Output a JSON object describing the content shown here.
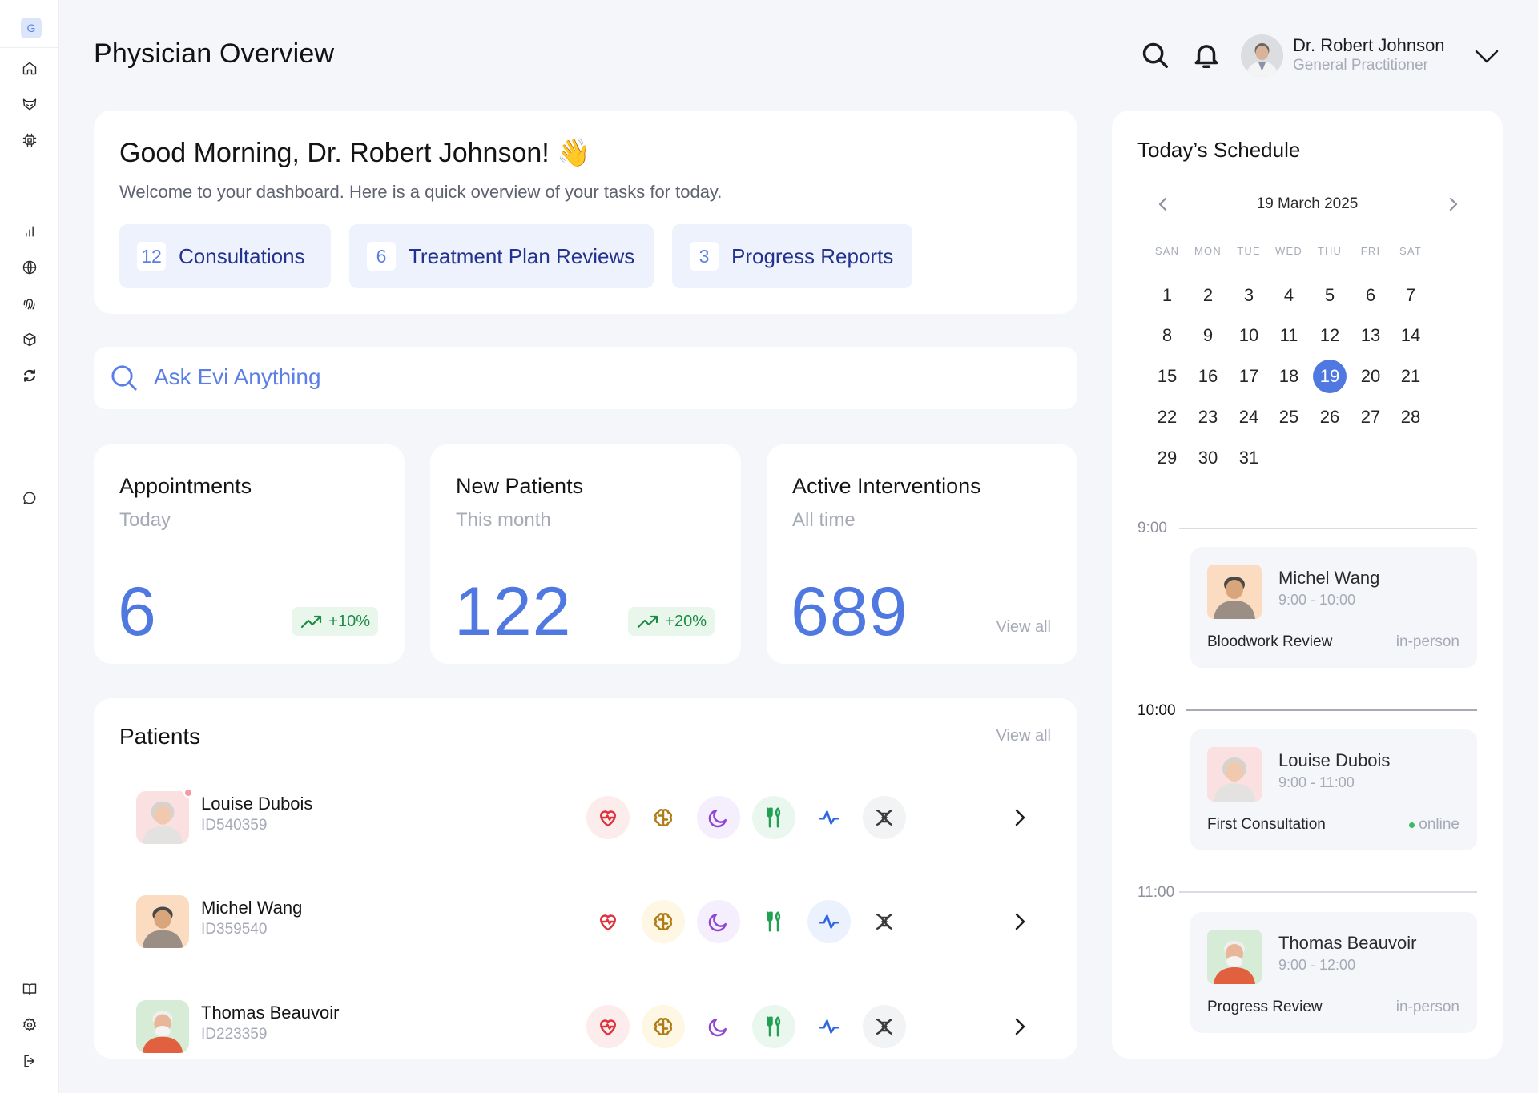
{
  "sidebar": {
    "logo": "G",
    "items": [
      {
        "icon": "home-icon"
      },
      {
        "icon": "fox-mask-icon"
      },
      {
        "icon": "chip-icon"
      },
      {
        "icon": "bar-chart-icon"
      },
      {
        "icon": "globe-icon"
      },
      {
        "icon": "fingerprint-icon"
      },
      {
        "icon": "cube-icon"
      },
      {
        "icon": "sync-icon"
      },
      {
        "icon": "chat-icon"
      },
      {
        "icon": "book-icon"
      },
      {
        "icon": "settings-icon"
      },
      {
        "icon": "logout-icon"
      }
    ]
  },
  "header": {
    "title": "Physician Overview",
    "user": {
      "name": "Dr. Robert Johnson",
      "role": "General Practitioner"
    }
  },
  "greeting": {
    "title": "Good Morning, Dr. Robert Johnson!",
    "emoji": "👋",
    "subtitle": "Welcome to your dashboard. Here is a quick overview of your tasks for today.",
    "tasks": [
      {
        "count": "12",
        "label": "Consultations"
      },
      {
        "count": "6",
        "label": "Treatment Plan Reviews"
      },
      {
        "count": "3",
        "label": "Progress Reports"
      }
    ]
  },
  "search": {
    "placeholder": "Ask Evi Anything"
  },
  "stats": [
    {
      "title": "Appointments",
      "subtitle": "Today",
      "value": "6",
      "trend": "+10%"
    },
    {
      "title": "New Patients",
      "subtitle": "This month",
      "value": "122",
      "trend": "+20%"
    },
    {
      "title": "Active Interventions",
      "subtitle": "All time",
      "value": "689",
      "link": "View all"
    }
  ],
  "patients": {
    "title": "Patients",
    "view_all": "View all",
    "rows": [
      {
        "name": "Louise Dubois",
        "id": "ID540359",
        "notification": true
      },
      {
        "name": "Michel Wang",
        "id": "ID359540",
        "notification": false
      },
      {
        "name": "Thomas Beauvoir",
        "id": "ID223359",
        "notification": false
      }
    ],
    "metric_icons": [
      "heart-icon",
      "brain-icon",
      "moon-icon",
      "fork-knife-icon",
      "activity-icon",
      "dna-icon"
    ],
    "colors": {
      "heart": "#e0323c",
      "brain": "#b07a14",
      "moon": "#8f45d6",
      "food": "#22a052",
      "activity": "#2f66e0",
      "dna": "#3a3a3a"
    }
  },
  "schedule": {
    "title": "Today’s Schedule",
    "month": "19 March 2025",
    "weekdays": [
      "SAN",
      "MON",
      "TUE",
      "WED",
      "THU",
      "FRI",
      "SAT"
    ],
    "selected_day": "19",
    "days": [
      "1",
      "2",
      "3",
      "4",
      "5",
      "6",
      "7",
      "8",
      "9",
      "10",
      "11",
      "12",
      "13",
      "14",
      "15",
      "16",
      "17",
      "18",
      "19",
      "20",
      "21",
      "22",
      "23",
      "24",
      "25",
      "26",
      "27",
      "28",
      "29",
      "30",
      "31"
    ],
    "times": [
      "9:00",
      "10:00",
      "11:00"
    ],
    "appointments": [
      {
        "name": "Michel Wang",
        "time": "9:00 - 10:00",
        "type": "Bloodwork Review",
        "mode": "in-person"
      },
      {
        "name": "Louise Dubois",
        "time": "9:00 - 11:00",
        "type": "First Consultation",
        "mode": "online"
      },
      {
        "name": "Thomas Beauvoir",
        "time": "9:00 - 12:00",
        "type": "Progress Review",
        "mode": "in-person"
      }
    ]
  },
  "colors": {
    "accent": "#4f78e1",
    "positive": "#1c8c45",
    "positive_bg": "#e8f6ec",
    "background": "#f5f6fa"
  }
}
